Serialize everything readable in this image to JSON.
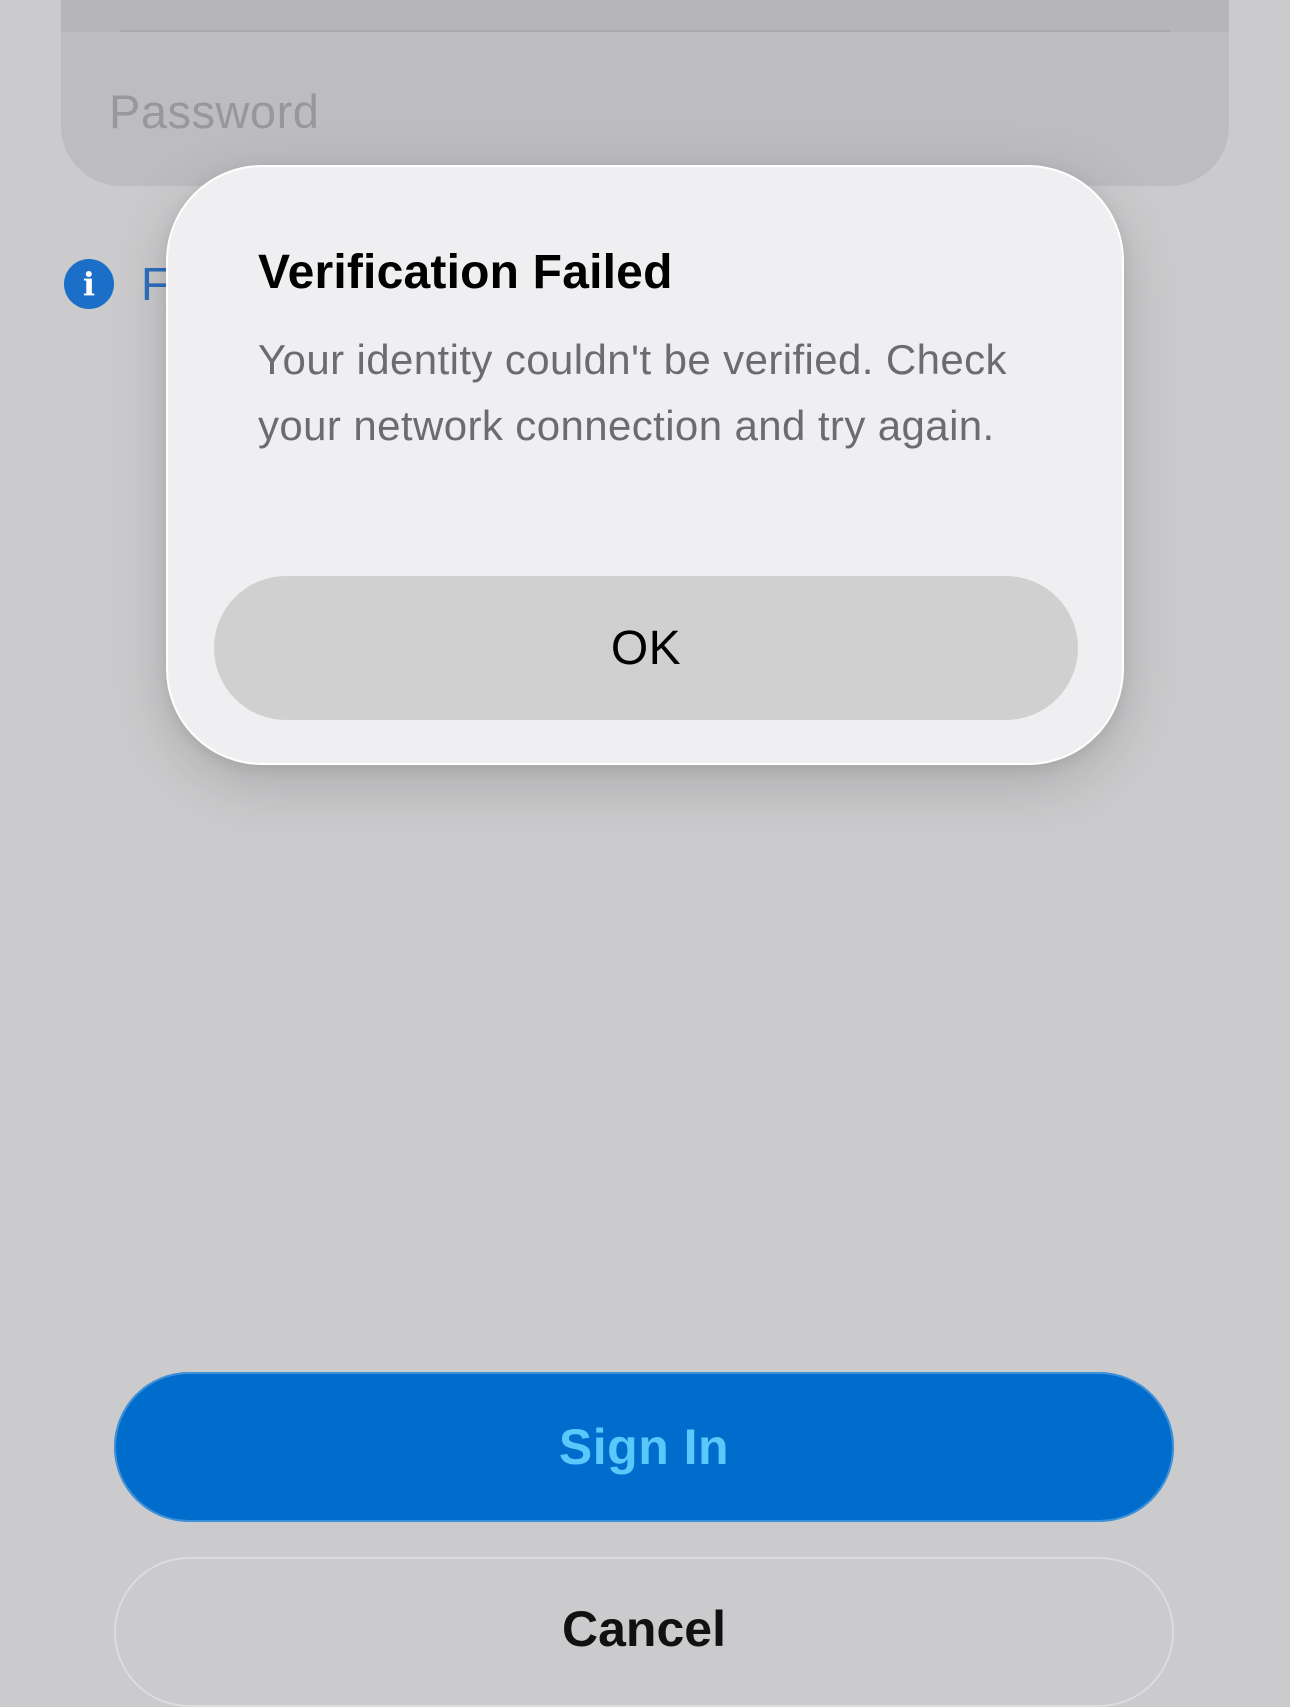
{
  "form": {
    "password_placeholder": "Password",
    "info_text_visible": "F"
  },
  "alert": {
    "title": "Verification Failed",
    "message": "Your identity couldn't be verified. Check your network connection and try again.",
    "ok_label": "OK"
  },
  "actions": {
    "signin_label": "Sign In",
    "cancel_label": "Cancel"
  },
  "icons": {
    "info_icon_glyph": "i"
  },
  "colors": {
    "accent": "#006dcc",
    "signin_text": "#5ac8fa",
    "info_icon": "#1b6fc9",
    "overlay_background": "#cbcbcd",
    "alert_background": "#efeff1"
  }
}
